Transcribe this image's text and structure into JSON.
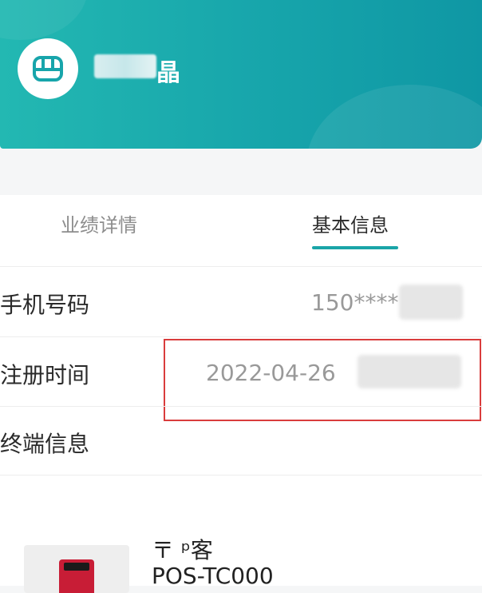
{
  "header": {
    "user_name_suffix": "晶",
    "avatar_icon": "store-icon"
  },
  "tabs": [
    {
      "label": "业绩详情",
      "active": false
    },
    {
      "label": "基本信息",
      "active": true
    }
  ],
  "info_rows": {
    "phone": {
      "label": "手机号码",
      "value": "150****"
    },
    "register_time": {
      "label": "注册时间",
      "value": "2022-04-26"
    },
    "terminal": {
      "label": "终端信息"
    }
  },
  "device": {
    "name": "〒 ᵖ客",
    "model": "POS-TC000"
  },
  "colors": {
    "header_gradient_start": "#23b8b2",
    "header_gradient_end": "#0f97a4",
    "accent": "#1aa5a8",
    "highlight_box": "#d93c3c"
  }
}
